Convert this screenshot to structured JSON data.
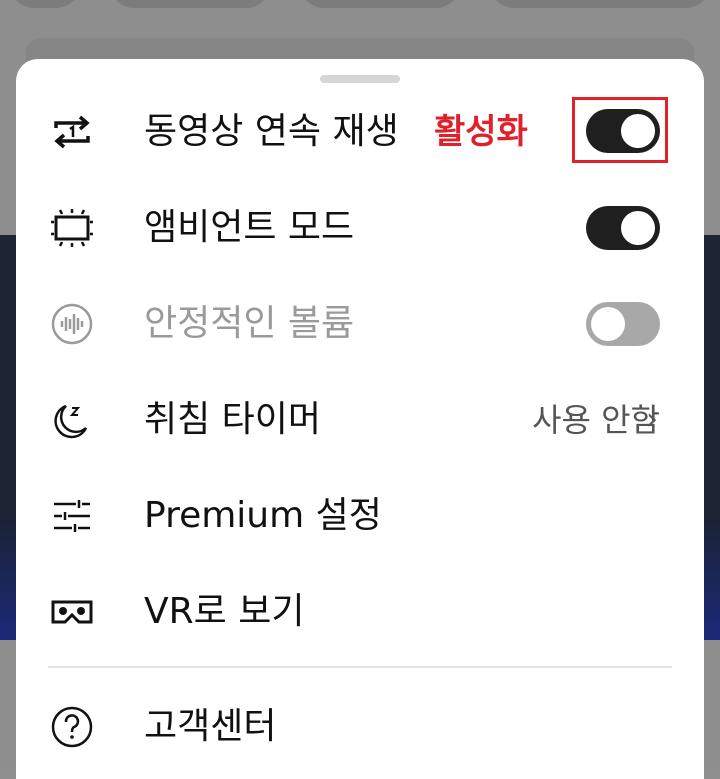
{
  "menu": {
    "items": [
      {
        "id": "autoplay",
        "label": "동영상 연속 재생",
        "icon": "repeat-one-icon",
        "type": "toggle",
        "state": "on",
        "annotation": "활성화"
      },
      {
        "id": "ambient",
        "label": "앰비언트 모드",
        "icon": "ambient-screen-icon",
        "type": "toggle",
        "state": "on"
      },
      {
        "id": "stable_volume",
        "label": "안정적인 볼륨",
        "icon": "waveform-icon",
        "type": "toggle",
        "state": "off",
        "disabled": true
      },
      {
        "id": "sleep_timer",
        "label": "취침 타이머",
        "icon": "moon-zzz-icon",
        "type": "link",
        "value": "사용 안함",
        "chevron": "›"
      },
      {
        "id": "premium",
        "label": "Premium 설정",
        "icon": "sliders-icon",
        "type": "link"
      },
      {
        "id": "vr",
        "label": "VR로 보기",
        "icon": "vr-headset-icon",
        "type": "link"
      },
      {
        "id": "help",
        "label": "고객센터",
        "icon": "help-circle-icon",
        "type": "link"
      }
    ]
  },
  "colors": {
    "accent_red": "#e0202a",
    "toggle_on": "#1f1f1f",
    "toggle_off": "#a8a8a8"
  }
}
